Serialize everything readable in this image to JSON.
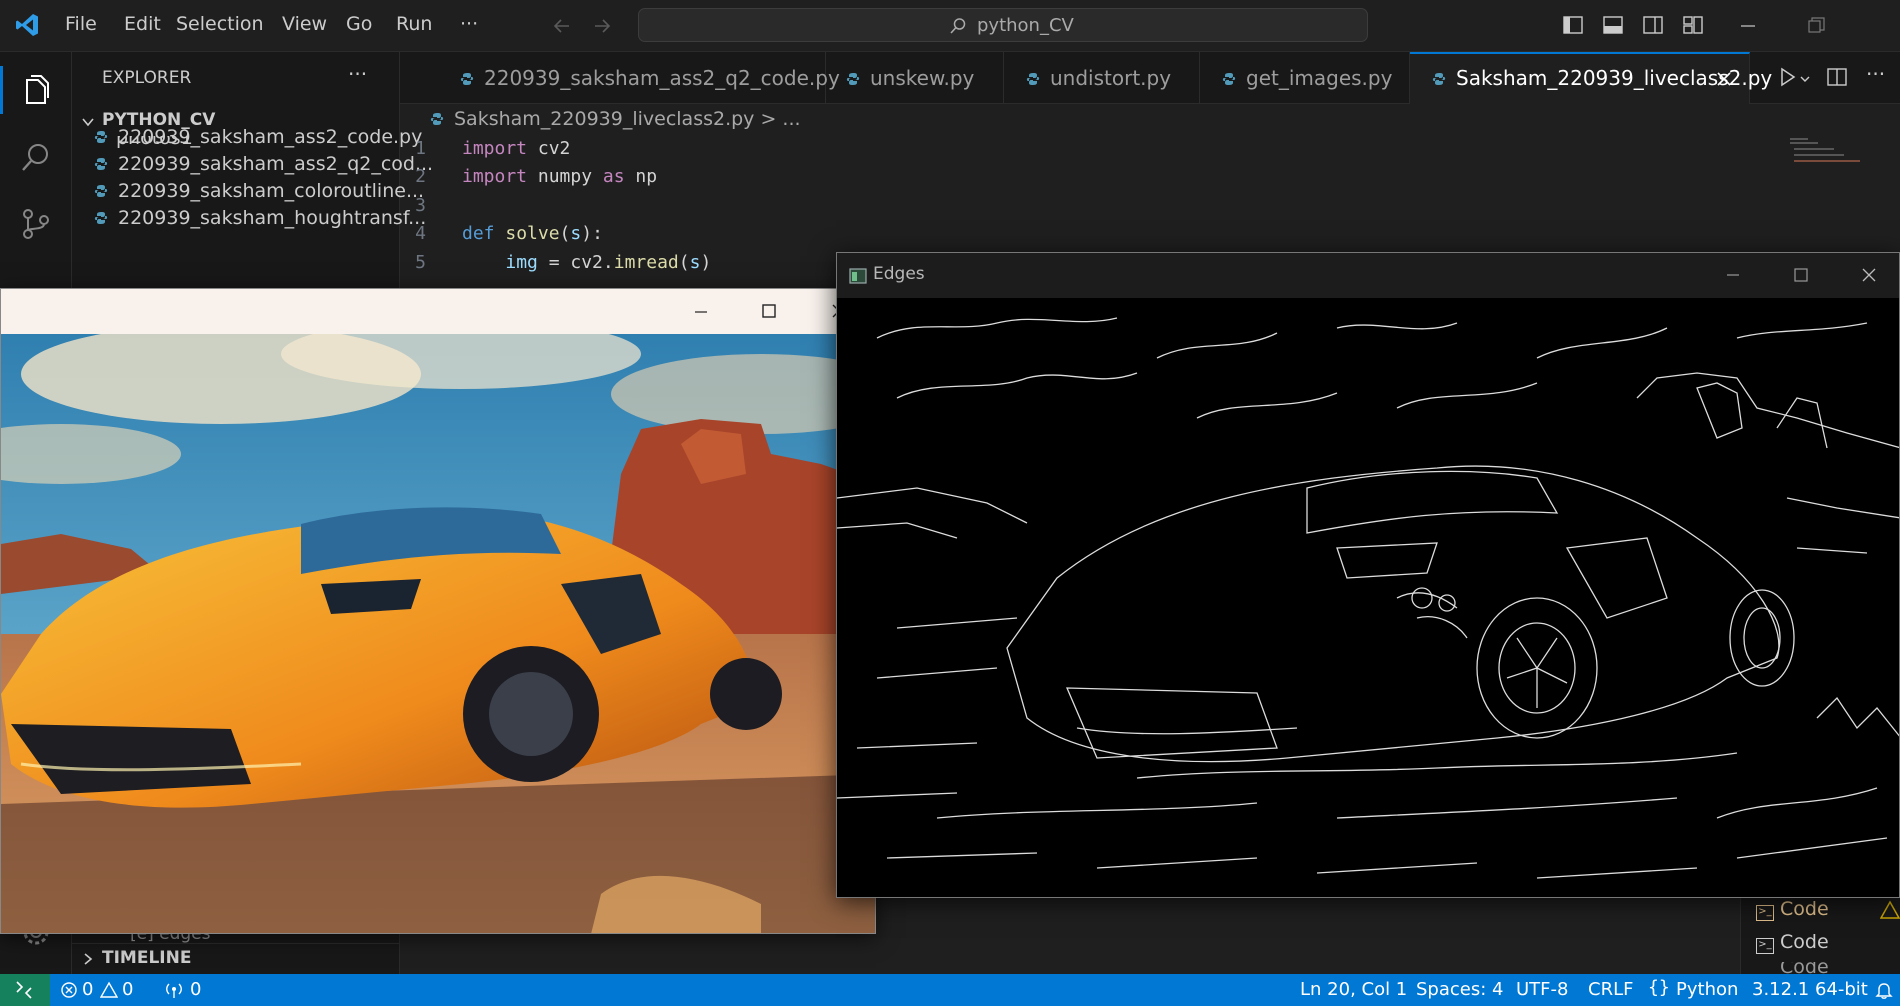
{
  "titlebar": {
    "menu": [
      "File",
      "Edit",
      "Selection",
      "View",
      "Go",
      "Run",
      "···"
    ],
    "search_text": "python_CV"
  },
  "sidebar": {
    "header": "EXPLORER",
    "header_more": "···",
    "project": "PYTHON_CV",
    "partial_item": "photos1",
    "files": [
      "220939_saksham_ass2_code.py",
      "220939_saksham_ass2_q2_cod...",
      "220939_saksham_coloroutline...",
      "220939_saksham_houghtransf..."
    ],
    "bottom_partial": "[e] edges",
    "timeline": "TIMELINE"
  },
  "tabs": [
    {
      "label": "220939_saksham_ass2_q2_code.py"
    },
    {
      "label": "unskew.py"
    },
    {
      "label": "undistort.py"
    },
    {
      "label": "get_images.py"
    },
    {
      "label": "Saksham_220939_liveclass2.py"
    }
  ],
  "breadcrumb": {
    "file": "Saksham_220939_liveclass2.py",
    "rest": "> ..."
  },
  "code": [
    {
      "n": "1",
      "tokens": [
        [
          "kw",
          "import"
        ],
        [
          "plain",
          " cv2"
        ]
      ]
    },
    {
      "n": "2",
      "tokens": [
        [
          "kw",
          "import"
        ],
        [
          "plain",
          " numpy "
        ],
        [
          "kw",
          "as"
        ],
        [
          "plain",
          " np"
        ]
      ]
    },
    {
      "n": "3",
      "tokens": []
    },
    {
      "n": "4",
      "tokens": [
        [
          "def",
          "def"
        ],
        [
          "plain",
          " "
        ],
        [
          "fn",
          "solve"
        ],
        [
          "plain",
          "("
        ],
        [
          "var",
          "s"
        ],
        [
          "plain",
          "):"
        ]
      ]
    },
    {
      "n": "5",
      "tokens": [
        [
          "plain",
          "    "
        ],
        [
          "var",
          "img"
        ],
        [
          "plain",
          " = cv2."
        ],
        [
          "fn",
          "imread"
        ],
        [
          "plain",
          "("
        ],
        [
          "var",
          "s"
        ],
        [
          "plain",
          ")"
        ]
      ]
    }
  ],
  "windows": {
    "edges_title": "Edges"
  },
  "terminal_list": [
    "Code",
    "Code",
    "Code"
  ],
  "statusbar": {
    "errors": "0",
    "warnings": "0",
    "ports": "0",
    "position": "Ln 20, Col 1",
    "spaces": "Spaces: 4",
    "encoding": "UTF-8",
    "eol": "CRLF",
    "language": "Python",
    "interpreter": "3.12.1 64-bit"
  },
  "colors": {
    "accent": "#0078d4",
    "remote": "#16825d",
    "python_icon": "#519aba"
  }
}
